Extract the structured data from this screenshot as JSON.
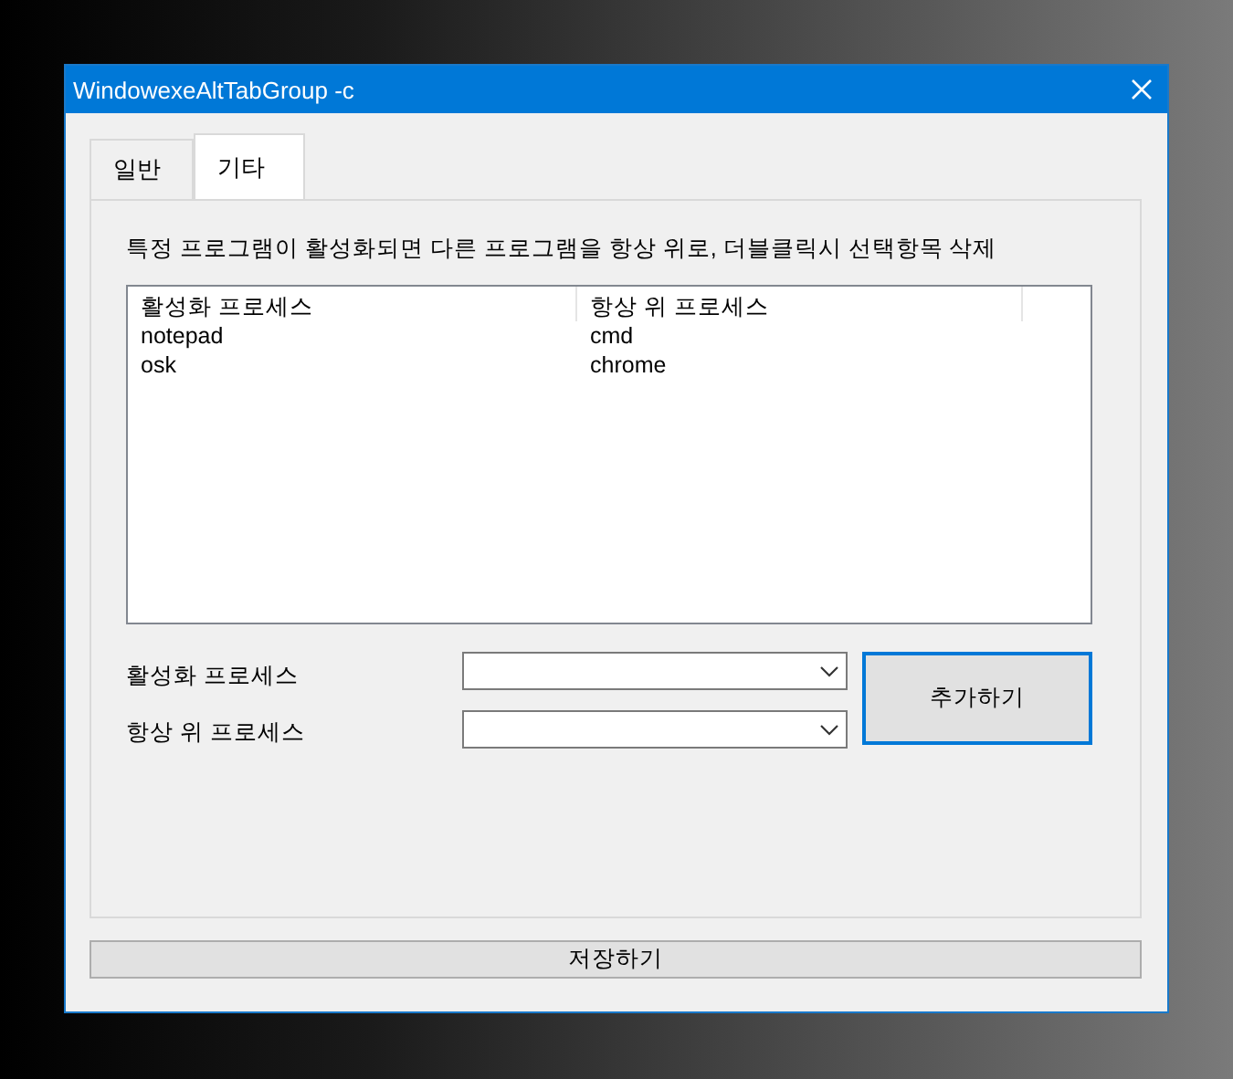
{
  "window": {
    "title": "WindowexeAltTabGroup -c"
  },
  "tabs": [
    {
      "label": "일반",
      "selected": false
    },
    {
      "label": "기타",
      "selected": true
    }
  ],
  "description": "특정 프로그램이 활성화되면 다른 프로그램을 항상 위로, 더블클릭시 선택항목 삭제",
  "table": {
    "columns": [
      "활성화 프로세스",
      "항상 위 프로세스"
    ],
    "rows": [
      [
        "notepad",
        "cmd"
      ],
      [
        "osk",
        "chrome"
      ]
    ]
  },
  "fields": [
    {
      "label": "활성화 프로세스"
    },
    {
      "label": "항상 위 프로세스"
    }
  ],
  "add_button": {
    "label": "추가하기",
    "focused": true
  },
  "save_button": {
    "label": "저장하기"
  }
}
